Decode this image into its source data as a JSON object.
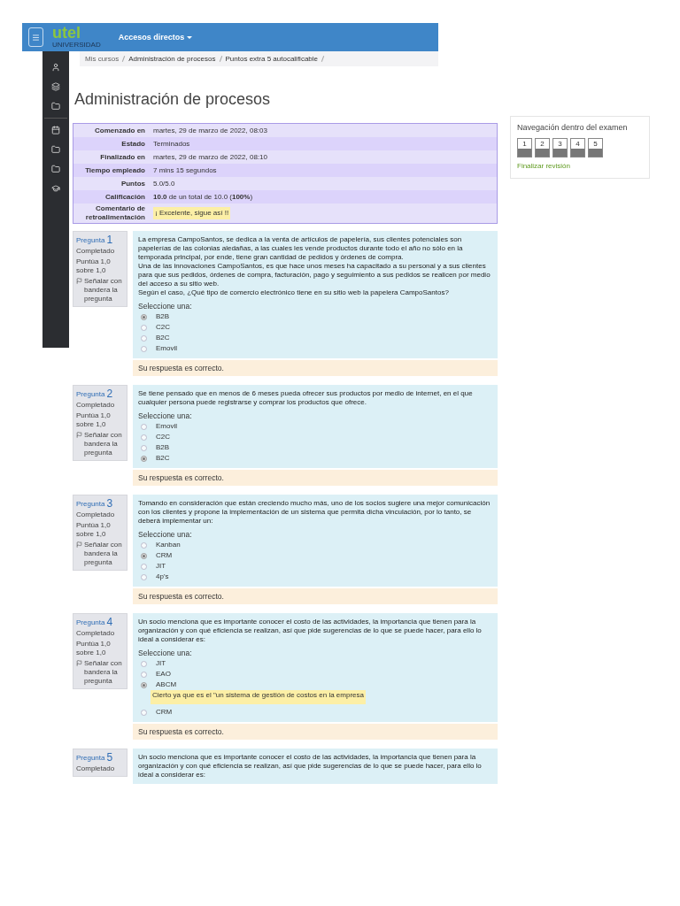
{
  "header": {
    "brand": "utel",
    "brand_sub": "UNIVERSIDAD",
    "menu": "Accesos directos"
  },
  "breadcrumb": [
    "Mis cursos",
    "Administración de procesos",
    "Puntos extra 5 autocalificable"
  ],
  "title": "Administración de procesos",
  "summary": [
    {
      "label": "Comenzado en",
      "value": "martes, 29 de marzo de 2022, 08:03",
      "kind": "text"
    },
    {
      "label": "Estado",
      "value": "Terminados",
      "kind": "text"
    },
    {
      "label": "Finalizado en",
      "value": "martes, 29 de marzo de 2022, 08:10",
      "kind": "text"
    },
    {
      "label": "Tiempo empleado",
      "value": "7 mins 15 segundos",
      "kind": "text"
    },
    {
      "label": "Puntos",
      "value": "5.0/5.0",
      "kind": "text"
    },
    {
      "label": "Calificación",
      "value": "**10.0** de un total de 10.0 (**100%**)",
      "kind": "text"
    },
    {
      "label": "Comentario de retroalimentación",
      "value": "¡ Excelente, sigue así !!",
      "kind": "note"
    }
  ],
  "navigation": {
    "title": "Navegación dentro del examen",
    "buttons": [
      {
        "label": "1",
        "answered": true
      },
      {
        "label": "2",
        "answered": true
      },
      {
        "label": "3",
        "answered": true
      },
      {
        "label": "4",
        "answered": true
      },
      {
        "label": "5",
        "answered": true
      }
    ],
    "finish": "Finalizar revisión"
  },
  "questions": [
    {
      "label": "Pregunta",
      "number": "1",
      "state": "Completado",
      "score": "Puntúa 1,0 sobre 1,0",
      "flag": "Señalar con bandera la pregunta",
      "text": [
        "La empresa CampoSantos, se dedica a la venta de artículos de papelería, sus clientes potenciales son papelerías de las colonias aledañas, a las cuales les vende productos durante todo el año no sólo en la temporada principal, por ende, tiene gran cantidad de pedidos y órdenes de compra.",
        "Una de las innovaciones CampoSantos, es que hace unos meses ha capacitado a su personal y a sus clientes para que sus pedidos, órdenes de compra, facturación, pago y seguimiento a sus pedidos se realicen por medio del acceso a su sitio web.",
        "Según el caso, ¿Qué tipo de comercio electrónico tiene en su sitio web la papelera CampoSantos?"
      ],
      "prompt": "Seleccione una:",
      "options": [
        {
          "label": "B2B",
          "selected": true
        },
        {
          "label": "C2C",
          "selected": false
        },
        {
          "label": "B2C",
          "selected": false
        },
        {
          "label": "Emovil",
          "selected": false
        }
      ],
      "result": "Su respuesta es correcto."
    },
    {
      "label": "Pregunta",
      "number": "2",
      "state": "Completado",
      "score": "Puntúa 1,0 sobre 1,0",
      "flag": "Señalar con bandera la pregunta",
      "text": [
        "Se tiene pensado que en menos de 6 meses pueda ofrecer sus productos por medio de internet, en el que cualquier persona puede registrarse y comprar los productos que ofrece."
      ],
      "prompt": "Seleccione una:",
      "options": [
        {
          "label": "Emovil",
          "selected": false
        },
        {
          "label": "C2C",
          "selected": false
        },
        {
          "label": "B2B",
          "selected": false
        },
        {
          "label": "B2C",
          "selected": true
        }
      ],
      "result": "Su respuesta es correcto."
    },
    {
      "label": "Pregunta",
      "number": "3",
      "state": "Completado",
      "score": "Puntúa 1,0 sobre 1,0",
      "flag": "Señalar con bandera la pregunta",
      "text": [
        "Tomando en consideración que están creciendo mucho más, uno de los socios sugiere una mejor comunicación con los clientes y propone la implementación de un sistema que permita dicha vinculación, por lo tanto, se deberá implementar un:"
      ],
      "prompt": "Seleccione una:",
      "options": [
        {
          "label": "Kanban",
          "selected": false
        },
        {
          "label": "CRM",
          "selected": true
        },
        {
          "label": "JIT",
          "selected": false
        },
        {
          "label": "4p's",
          "selected": false
        }
      ],
      "result": "Su respuesta es correcto."
    },
    {
      "label": "Pregunta",
      "number": "4",
      "state": "Completado",
      "score": "Puntúa 1,0 sobre 1,0",
      "flag": "Señalar con bandera la pregunta",
      "text": [
        "Un socio menciona que es importante conocer el costo de las actividades, la importancia que tienen para la organización y con qué eficiencia se realizan, así que pide sugerencias de lo que se puede hacer, para ello lo ideal a considerar es:"
      ],
      "prompt": "Seleccione una:",
      "options": [
        {
          "label": "JIT",
          "selected": false
        },
        {
          "label": "EAO",
          "selected": false
        },
        {
          "label": "ABCM",
          "selected": true,
          "feedback": "Cierto ya que es el \"un sistema de gestión de costos en la empresa"
        },
        {
          "label": "CRM",
          "selected": false
        }
      ],
      "result": "Su respuesta es correcto."
    },
    {
      "label": "Pregunta",
      "number": "5",
      "state": "Completado",
      "text": [
        "Un socio menciona que es importante conocer el costo de las actividades, la importancia que tienen para la organización y con qué eficiencia se realizan, así que pide sugerencias de lo que se puede hacer, para ello lo ideal a considerar es:"
      ]
    }
  ]
}
